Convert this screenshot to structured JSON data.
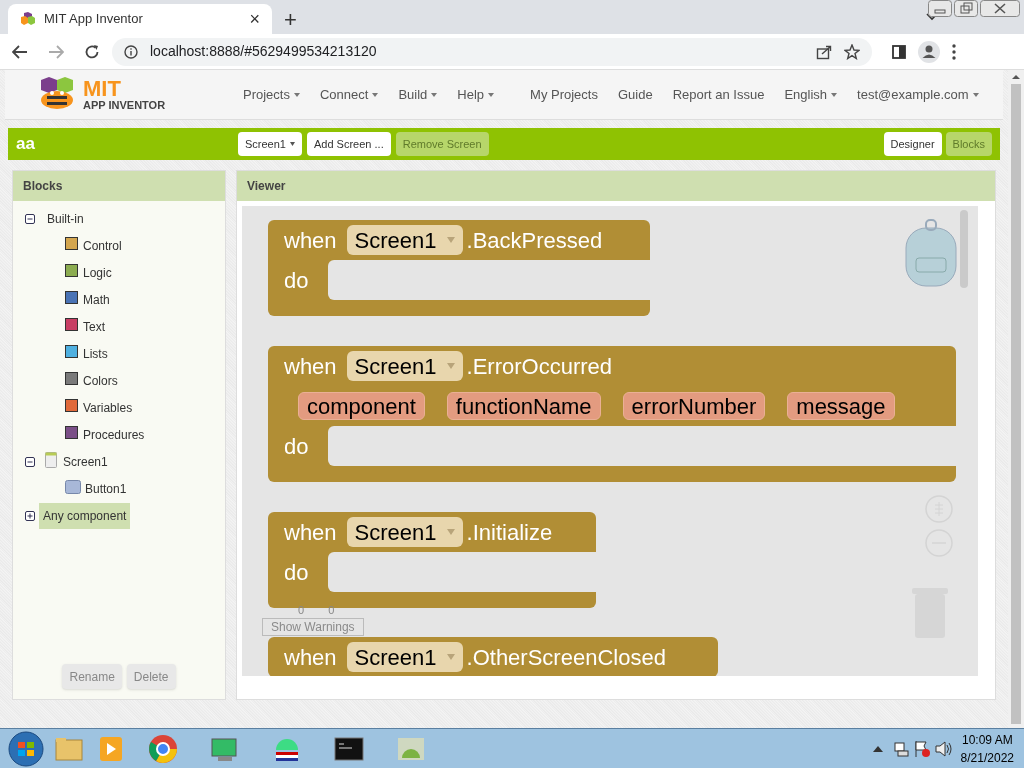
{
  "browser": {
    "tab_title": "MIT App Inventor",
    "tab_close": "×",
    "new_tab": "+",
    "url": "localhost:8888/#5629499534213120"
  },
  "app_header": {
    "logo_title": "MIT",
    "logo_subtitle": "APP INVENTOR",
    "menus": [
      {
        "label": "Projects",
        "dropdown": true
      },
      {
        "label": "Connect",
        "dropdown": true
      },
      {
        "label": "Build",
        "dropdown": true
      },
      {
        "label": "Help",
        "dropdown": true
      },
      {
        "label": "My Projects",
        "dropdown": false
      },
      {
        "label": "Guide",
        "dropdown": false
      },
      {
        "label": "Report an Issue",
        "dropdown": false
      },
      {
        "label": "English",
        "dropdown": true
      },
      {
        "label": "test@example.com",
        "dropdown": true
      }
    ]
  },
  "project_bar": {
    "project_name": "aa",
    "buttons": [
      {
        "label": "Screen1",
        "dropdown": true,
        "disabled": false
      },
      {
        "label": "Add Screen ...",
        "dropdown": false,
        "disabled": false
      },
      {
        "label": "Remove Screen",
        "dropdown": false,
        "disabled": true
      }
    ],
    "views": [
      {
        "label": "Designer",
        "selected": false
      },
      {
        "label": "Blocks",
        "selected": true
      }
    ]
  },
  "blocks_panel": {
    "title": "Blocks",
    "tree": [
      {
        "label": "Built-in",
        "kind": "group",
        "expanded": true,
        "selected": false,
        "children": [
          {
            "label": "Control",
            "kind": "category",
            "color": "#d4a64f",
            "selected": false
          },
          {
            "label": "Logic",
            "kind": "category",
            "color": "#8cac50",
            "selected": false
          },
          {
            "label": "Math",
            "kind": "category",
            "color": "#4a73b5",
            "selected": false
          },
          {
            "label": "Text",
            "kind": "category",
            "color": "#c83e63",
            "selected": false
          },
          {
            "label": "Lists",
            "kind": "category",
            "color": "#4fb0e0",
            "selected": false
          },
          {
            "label": "Colors",
            "kind": "category",
            "color": "#7a7a7a",
            "selected": false
          },
          {
            "label": "Variables",
            "kind": "category",
            "color": "#e0693a",
            "selected": false
          },
          {
            "label": "Procedures",
            "kind": "category",
            "color": "#7b4f87",
            "selected": false
          }
        ]
      },
      {
        "label": "Screen1",
        "kind": "screen",
        "expanded": true,
        "selected": false,
        "children": [
          {
            "label": "Button1",
            "kind": "button",
            "selected": false
          }
        ]
      },
      {
        "label": "Any component",
        "kind": "group",
        "expanded": false,
        "selected": true
      }
    ],
    "buttons": [
      "Rename",
      "Delete"
    ]
  },
  "viewer": {
    "title": "Viewer",
    "warnings": {
      "warning_count": "0",
      "error_count": "0",
      "button": "Show Warnings"
    },
    "blocks": [
      {
        "when": "when",
        "component": "Screen1",
        "event": ".BackPressed",
        "do": "do"
      },
      {
        "when": "when",
        "component": "Screen1",
        "event": ".ErrorOccurred",
        "params": [
          "component",
          "functionName",
          "errorNumber",
          "message"
        ],
        "do": "do"
      },
      {
        "when": "when",
        "component": "Screen1",
        "event": ".Initialize",
        "do": "do"
      },
      {
        "when": "when",
        "component": "Screen1",
        "event": ".OtherScreenClosed"
      }
    ]
  },
  "taskbar": {
    "time": "10:09 AM",
    "date": "8/21/2022"
  }
}
